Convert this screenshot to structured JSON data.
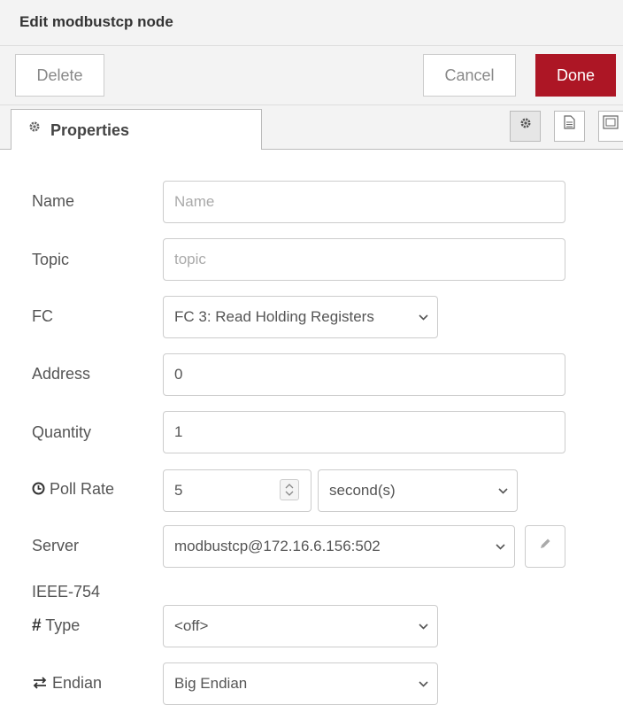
{
  "header": {
    "title": "Edit modbustcp node",
    "delete_label": "Delete",
    "cancel_label": "Cancel",
    "done_label": "Done"
  },
  "tabs": {
    "properties_label": "Properties",
    "icons": [
      "gear-icon",
      "description-icon",
      "appearance-icon"
    ]
  },
  "form": {
    "name": {
      "label": "Name",
      "placeholder": "Name",
      "value": ""
    },
    "topic": {
      "label": "Topic",
      "placeholder": "topic",
      "value": ""
    },
    "fc": {
      "label": "FC",
      "selected": "FC 3: Read Holding Registers"
    },
    "address": {
      "label": "Address",
      "value": "0"
    },
    "quantity": {
      "label": "Quantity",
      "value": "1"
    },
    "poll_rate": {
      "label": "Poll Rate",
      "value": "5",
      "unit": "second(s)"
    },
    "server": {
      "label": "Server",
      "selected": "modbustcp@172.16.6.156:502"
    },
    "ieee_label": "IEEE-754",
    "type": {
      "label": "Type",
      "selected": "<off>"
    },
    "endian": {
      "label": "Endian",
      "selected": "Big Endian"
    }
  },
  "colors": {
    "done_button": "#ad1625",
    "panel_bg": "#f3f3f3",
    "border": "#cccccc"
  }
}
